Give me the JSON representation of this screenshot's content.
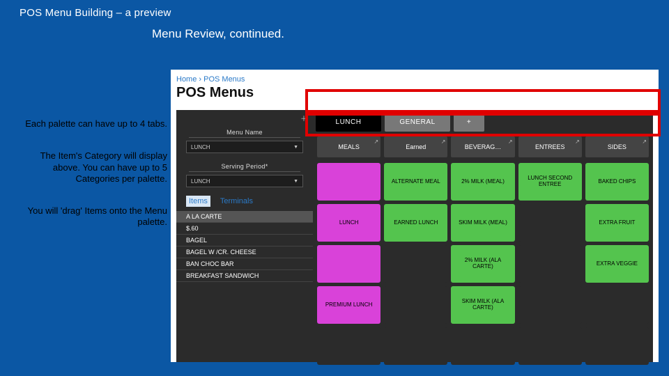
{
  "slide": {
    "title": "POS Menu Building – a preview",
    "subheading": "Menu Review,  continued."
  },
  "annotations": [
    "Each palette can have up to 4 tabs.",
    "The Item's Category will display above. You can have up to 5 Categories per palette.",
    "You will 'drag' Items onto the Menu palette."
  ],
  "app": {
    "breadcrumb": "Home › POS Menus",
    "heading": "POS Menus",
    "config": {
      "menu_name_label": "Menu Name",
      "menu_name_value": "LUNCH",
      "serving_period_label": "Serving Period*",
      "serving_period_value": "LUNCH",
      "items_tab": "Items",
      "terminals_tab": "Terminals",
      "items": [
        "A LA CARTE",
        "$.60",
        "BAGEL",
        "BAGEL W /CR. CHEESE",
        "BAN CHOC BAR",
        "BREAKFAST SANDWICH"
      ]
    },
    "palette_tabs": {
      "active": "LUNCH",
      "other": "GENERAL",
      "add": "+"
    },
    "categories": [
      "MEALS",
      "Earned",
      "BEVERAG…",
      "ENTREES",
      "SIDES"
    ],
    "grid": [
      {
        "label": "",
        "cls": "magenta"
      },
      {
        "label": "ALTERNATE MEAL",
        "cls": "green"
      },
      {
        "label": "2% MILK (MEAL)",
        "cls": "green"
      },
      {
        "label": "LUNCH SECOND ENTREE",
        "cls": "green"
      },
      {
        "label": "BAKED CHIPS",
        "cls": "green"
      },
      {
        "label": "LUNCH",
        "cls": "magenta"
      },
      {
        "label": "EARNED LUNCH",
        "cls": "green"
      },
      {
        "label": "SKIM MILK (MEAL)",
        "cls": "green"
      },
      {
        "label": "",
        "cls": "empty"
      },
      {
        "label": "EXTRA FRUIT",
        "cls": "green"
      },
      {
        "label": "",
        "cls": "magenta"
      },
      {
        "label": "",
        "cls": "empty"
      },
      {
        "label": "2% MILK (ALA CARTE)",
        "cls": "green"
      },
      {
        "label": "",
        "cls": "empty"
      },
      {
        "label": "EXTRA VEGGIE",
        "cls": "green"
      },
      {
        "label": "PREMIUM LUNCH",
        "cls": "magenta"
      },
      {
        "label": "",
        "cls": "empty"
      },
      {
        "label": "SKIM MILK (ALA CARTE)",
        "cls": "green"
      },
      {
        "label": "",
        "cls": "empty"
      },
      {
        "label": "",
        "cls": "empty"
      },
      {
        "label": "",
        "cls": "empty"
      },
      {
        "label": "",
        "cls": "empty"
      },
      {
        "label": "",
        "cls": "empty"
      },
      {
        "label": "",
        "cls": "empty"
      },
      {
        "label": "",
        "cls": "empty"
      }
    ]
  }
}
